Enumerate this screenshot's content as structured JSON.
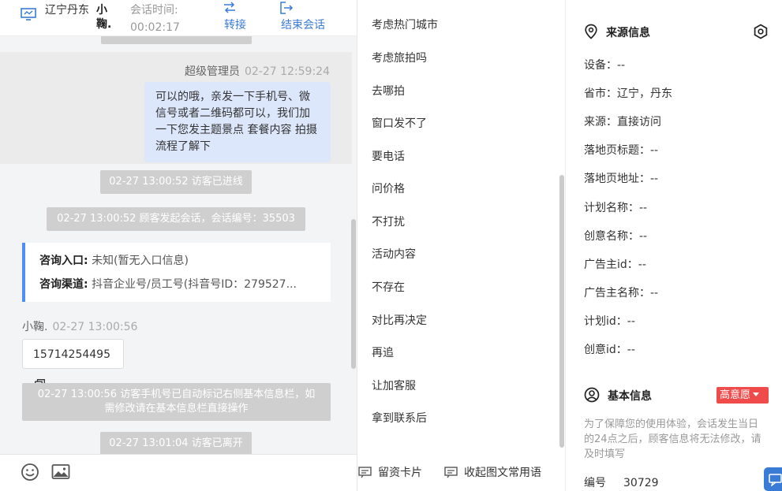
{
  "header": {
    "city": "辽宁丹东",
    "agent": "小鞠.",
    "session_time_label": "会话时间:",
    "session_time": "00:02:17",
    "transfer_label": "转接",
    "end_label": "结束会话"
  },
  "chat": {
    "agent_name": "超级管理员",
    "agent_time": "02-27 12:59:24",
    "agent_message": "可以的哦，亲发一下手机号、微信号或者二维码都可以，我们加一下您发主题景点 套餐内容 拍摄流程了解下",
    "sys_joined": "02-27 13:00:52 访客已进线",
    "sys_started": "02-27 13:00:52 顾客发起会话，会话编号：35503",
    "consult_entry_label": "咨询入口:",
    "consult_entry_value": "未知(暂无入口信息)",
    "consult_channel_label": "咨询渠道:",
    "consult_channel_value": "抖音企业号/员工号(抖音号ID：279527...",
    "visitor_name": "小鞠.",
    "visitor_time": "02-27 13:00:56",
    "visitor_phone": "15714254495",
    "sys_phone_marked": "02-27 13:00:56 访客手机号已自动标记右侧基本信息栏，如需修改请在基本信息栏直接操作",
    "sys_left": "02-27 13:01:04 访客已离开"
  },
  "quick_replies": [
    "考虑热门城市",
    "考虑旅拍吗",
    "去哪拍",
    "窗口发不了",
    "要电话",
    "问价格",
    "不打扰",
    "活动内容",
    "不存在",
    "对比再决定",
    "再追",
    "让加客服",
    "拿到联系后"
  ],
  "reply_footer": {
    "card_label": "留资卡片",
    "collapse_label": "收起图文常用语"
  },
  "source_info": {
    "title": "来源信息",
    "device": "设备：--",
    "province": "省市：辽宁，丹东",
    "source": "来源：直接访问",
    "landing_title": "落地页标题：--",
    "landing_url": "落地页地址：--",
    "plan_name": "计划名称：--",
    "creative_name": "创意名称：--",
    "advertiser_id": "广告主id：--",
    "advertiser_name": "广告主名称：--",
    "plan_id": "计划id：--",
    "creative_id": "创意id：--"
  },
  "basic_info": {
    "title": "基本信息",
    "intent_badge": "高意愿",
    "notice": "为了保障您的使用体验，会话发生当日的24点之后，顾客信息将无法修改，请及时填写",
    "number_label": "编号",
    "number_value": "30729"
  },
  "colors": {
    "accent": "#3a7bd5",
    "bubble": "#dce7fb",
    "badge": "#f04b4b"
  }
}
